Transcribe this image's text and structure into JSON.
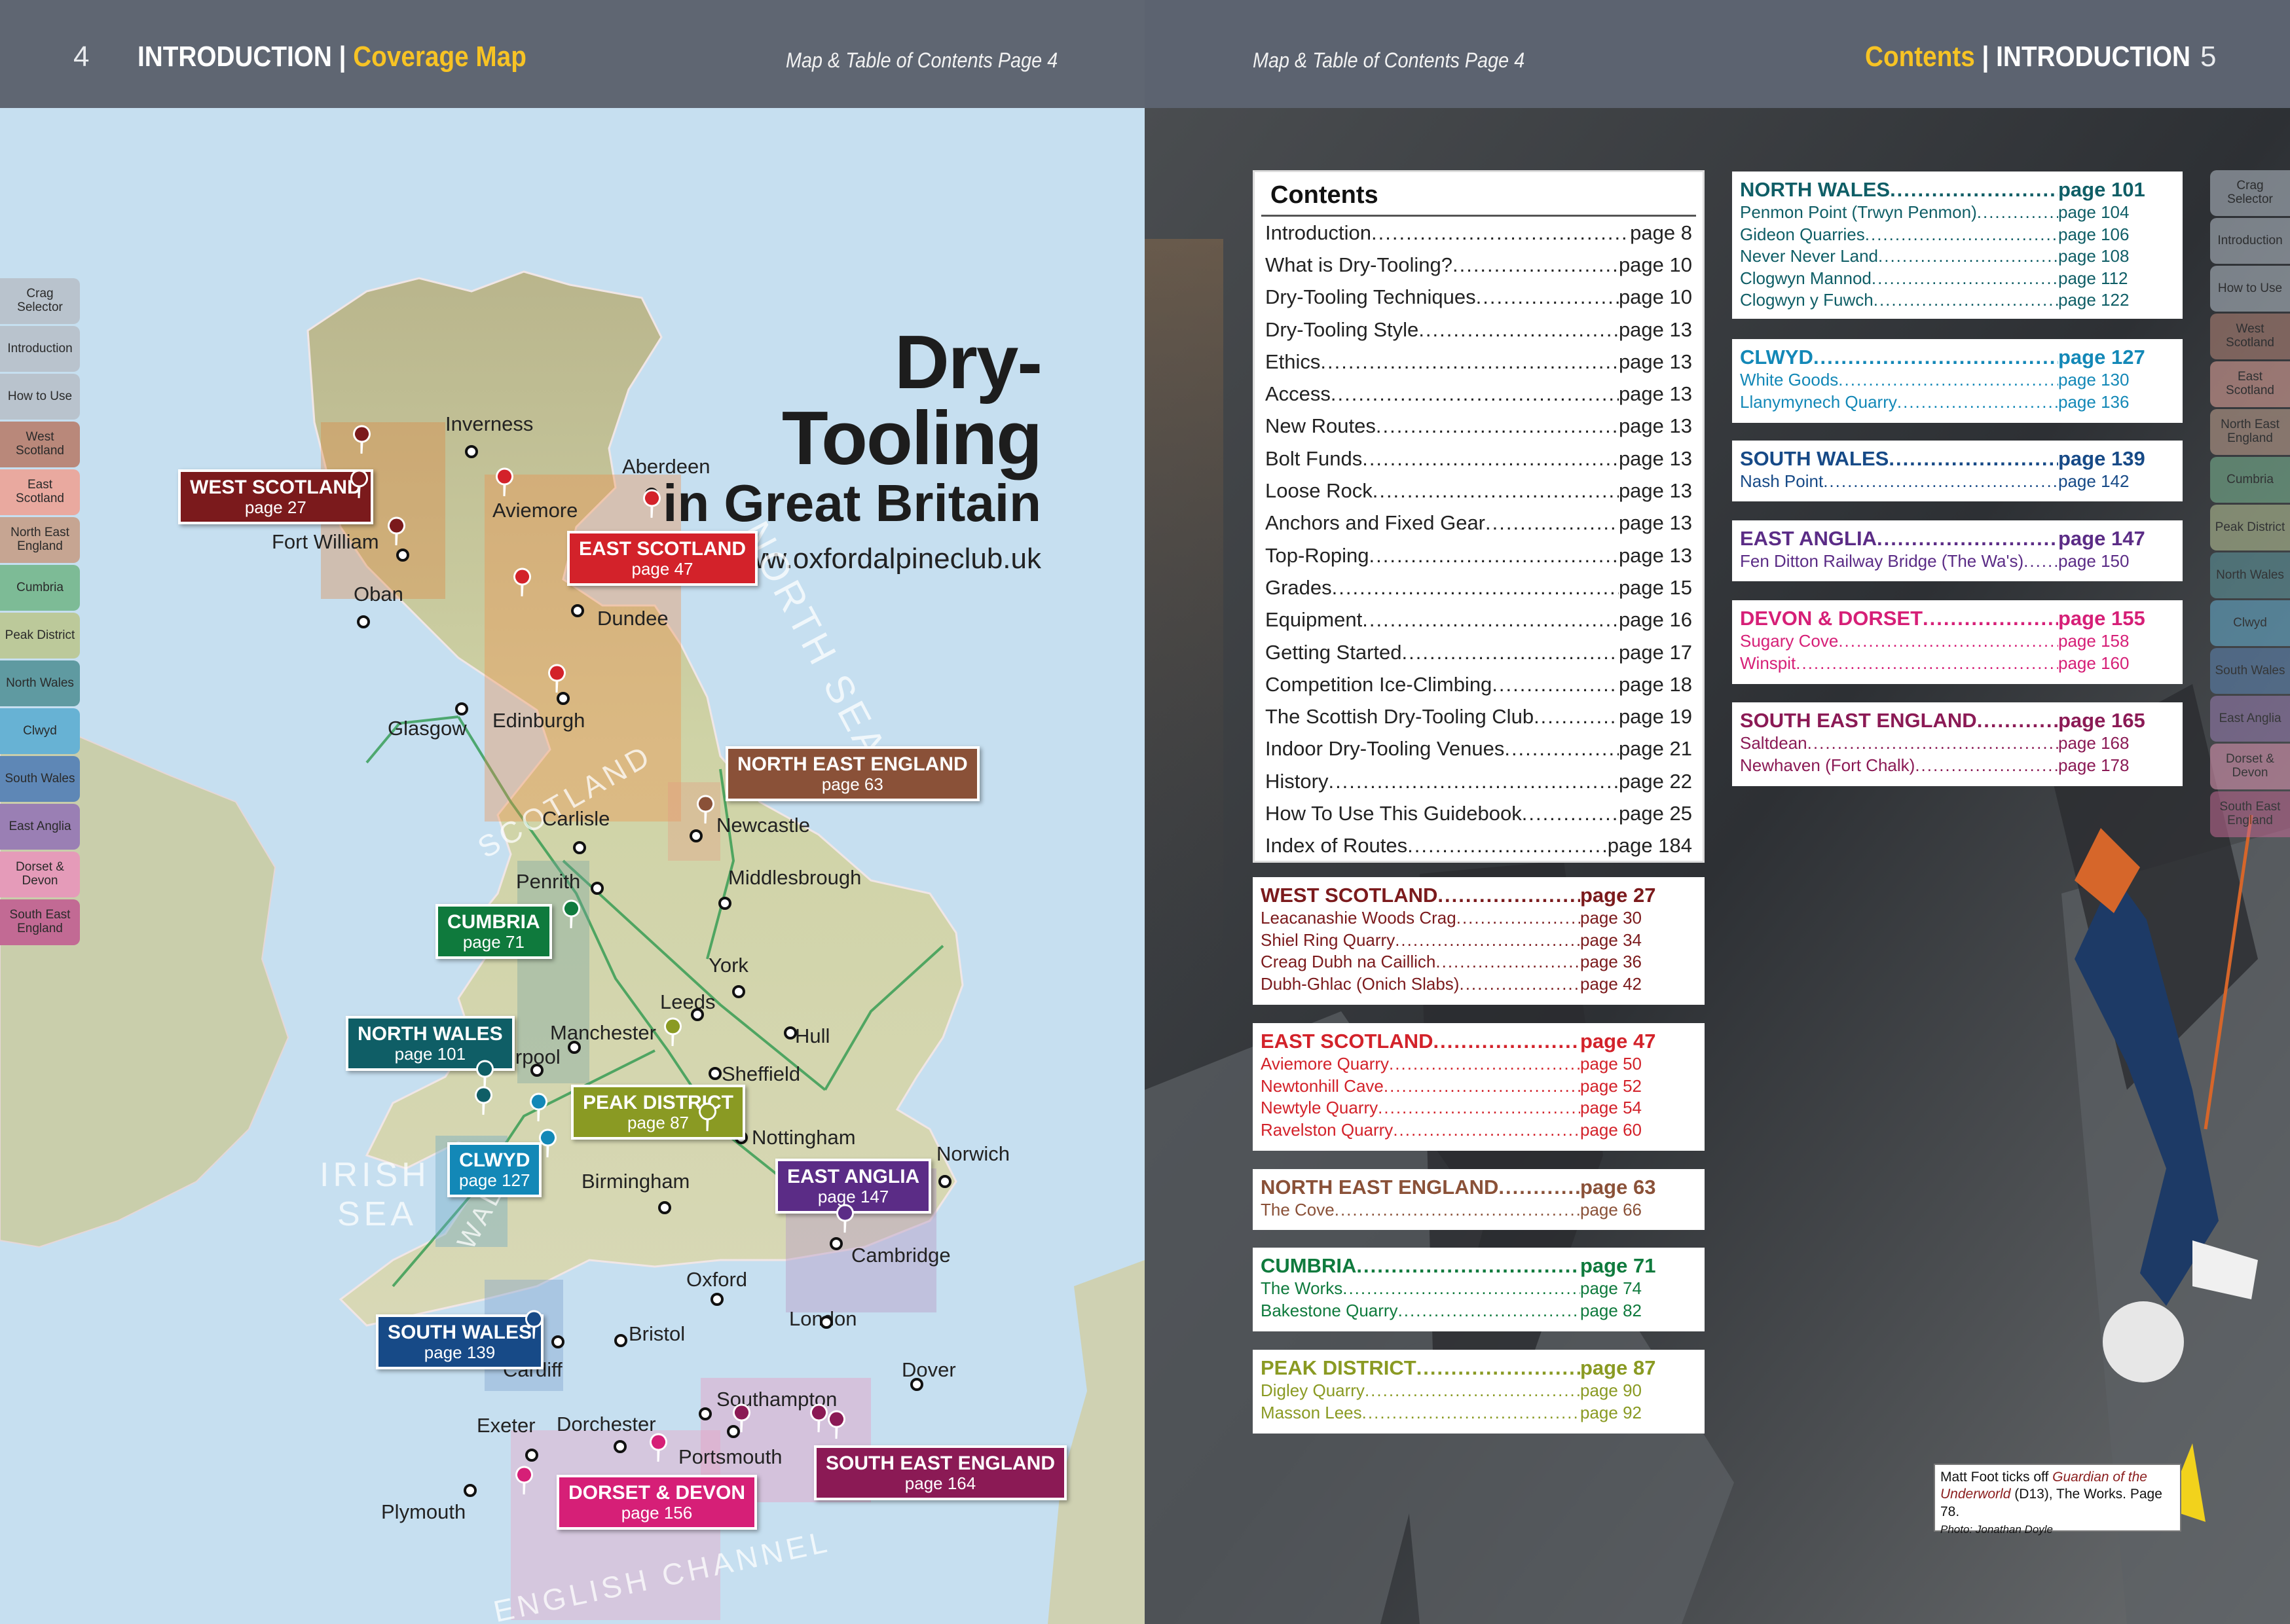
{
  "header_left": {
    "page_number": "4",
    "section": "INTRODUCTION",
    "separator": "|",
    "subsection": "Coverage Map",
    "map_ref": "Map & Table of Contents Page 4"
  },
  "header_right": {
    "map_ref": "Map & Table of Contents Page 4",
    "subsection": "Contents",
    "separator": "|",
    "section": "INTRODUCTION",
    "page_number": "5"
  },
  "side_tabs": [
    {
      "label": "Crag Selector",
      "color": "#b9c3cd"
    },
    {
      "label": "Introduction",
      "color": "#b9c3cd"
    },
    {
      "label": "How to Use",
      "color": "#b9c3cd"
    },
    {
      "label": "West Scotland",
      "color": "#b9887a"
    },
    {
      "label": "East Scotland",
      "color": "#e9a99f"
    },
    {
      "label": "North East England",
      "color": "#c6a592"
    },
    {
      "label": "Cumbria",
      "color": "#7dbb96"
    },
    {
      "label": "Peak District",
      "color": "#bcc99a"
    },
    {
      "label": "North Wales",
      "color": "#5f9aa1"
    },
    {
      "label": "Clwyd",
      "color": "#67b2d4"
    },
    {
      "label": "South Wales",
      "color": "#5e87b6"
    },
    {
      "label": "East Anglia",
      "color": "#9a7fb4"
    },
    {
      "label": "Dorset & Devon",
      "color": "#e59bb9"
    },
    {
      "label": "South East England",
      "color": "#c26a94"
    }
  ],
  "map_title": {
    "line1": "Dry-Tooling",
    "line2": "in Great Britain",
    "url": "www.oxfordalpineclub.uk"
  },
  "towns": [
    "Inverness",
    "Aberdeen",
    "Aviemore",
    "Fort William",
    "Oban",
    "Dundee",
    "Glasgow",
    "Edinburgh",
    "Carlisle",
    "Newcastle",
    "Penrith",
    "Middlesbrough",
    "York",
    "Leeds",
    "Hull",
    "Manchester",
    "Liverpool",
    "Sheffield",
    "Nottingham",
    "Norwich",
    "Birmingham",
    "Cambridge",
    "Oxford",
    "London",
    "Bristol",
    "Cardiff",
    "Dover",
    "Southampton",
    "Exeter",
    "Dorchester",
    "Portsmouth",
    "Plymouth"
  ],
  "seas": [
    "NORTH SEA",
    "IRISH",
    "SEA",
    "ENGLISH CHANNEL",
    "SCOTLAND",
    "WALES"
  ],
  "regions": [
    {
      "name": "WEST SCOTLAND",
      "page": "page 27",
      "color": "#7b1a1c"
    },
    {
      "name": "EAST SCOTLAND",
      "page": "page 47",
      "color": "#d3222a"
    },
    {
      "name": "NORTH EAST ENGLAND",
      "page": "page 63",
      "color": "#8a5138"
    },
    {
      "name": "CUMBRIA",
      "page": "page 71",
      "color": "#0f7a3d"
    },
    {
      "name": "NORTH WALES",
      "page": "page 101",
      "color": "#0f5e66"
    },
    {
      "name": "PEAK DISTRICT",
      "page": "page 87",
      "color": "#8a9a23"
    },
    {
      "name": "CLWYD",
      "page": "page 127",
      "color": "#1388b7"
    },
    {
      "name": "EAST ANGLIA",
      "page": "page 147",
      "color": "#5b2c86"
    },
    {
      "name": "SOUTH WALES",
      "page": "page 139",
      "color": "#174a87"
    },
    {
      "name": "DORSET & DEVON",
      "page": "page 156",
      "color": "#d61f77"
    },
    {
      "name": "SOUTH EAST ENGLAND",
      "page": "page 164",
      "color": "#8b1a55"
    }
  ],
  "contents": {
    "heading": "Contents",
    "rows": [
      {
        "label": "Introduction",
        "page": "page 8"
      },
      {
        "label": "What is Dry-Tooling?",
        "page": "page 10"
      },
      {
        "label": "Dry-Tooling Techniques",
        "page": "page 10"
      },
      {
        "label": "Dry-Tooling Style",
        "page": "page 13"
      },
      {
        "label": "Ethics",
        "page": "page 13"
      },
      {
        "label": "Access",
        "page": "page 13"
      },
      {
        "label": "New Routes",
        "page": "page 13"
      },
      {
        "label": "Bolt Funds",
        "page": "page 13"
      },
      {
        "label": "Loose Rock",
        "page": "page 13"
      },
      {
        "label": "Anchors and Fixed Gear",
        "page": "page 13"
      },
      {
        "label": "Top-Roping",
        "page": "page 13"
      },
      {
        "label": "Grades",
        "page": "page 15"
      },
      {
        "label": "Equipment",
        "page": "page 16"
      },
      {
        "label": "Getting Started",
        "page": "page 17"
      },
      {
        "label": "Competition Ice-Climbing",
        "page": "page 18"
      },
      {
        "label": "The Scottish Dry-Tooling Club",
        "page": "page 19"
      },
      {
        "label": "Indoor Dry-Tooling Venues",
        "page": "page 21"
      },
      {
        "label": "History",
        "page": "page 22"
      },
      {
        "label": "How To Use This Guidebook",
        "page": "page 25"
      },
      {
        "label": "Index of Routes",
        "page": "page 184"
      }
    ]
  },
  "sections_left": [
    {
      "title": "WEST SCOTLAND",
      "page": "page 27",
      "color": "#7b1a1c",
      "items": [
        {
          "label": "Leacanashie Woods Crag",
          "page": "page 30"
        },
        {
          "label": "Shiel Ring Quarry",
          "page": "page 34"
        },
        {
          "label": "Creag Dubh na Caillich",
          "page": "page 36"
        },
        {
          "label": "Dubh-Ghlac (Onich Slabs)",
          "page": "page 42"
        }
      ]
    },
    {
      "title": "EAST SCOTLAND",
      "page": "page 47",
      "color": "#d3222a",
      "items": [
        {
          "label": "Aviemore Quarry",
          "page": "page 50"
        },
        {
          "label": "Newtonhill Cave",
          "page": "page 52"
        },
        {
          "label": "Newtyle Quarry",
          "page": "page 54"
        },
        {
          "label": "Ravelston Quarry",
          "page": "page 60"
        }
      ]
    },
    {
      "title": "NORTH EAST ENGLAND",
      "page": "page 63",
      "color": "#8a5138",
      "items": [
        {
          "label": "The Cove",
          "page": "page 66"
        }
      ]
    },
    {
      "title": "CUMBRIA",
      "page": "page 71",
      "color": "#0f7a3d",
      "items": [
        {
          "label": "The Works",
          "page": "page 74"
        },
        {
          "label": "Bakestone Quarry",
          "page": "page 82"
        }
      ]
    },
    {
      "title": "PEAK DISTRICT",
      "page": "page 87",
      "color": "#8a9a23",
      "items": [
        {
          "label": "Digley Quarry",
          "page": "page 90"
        },
        {
          "label": "Masson Lees",
          "page": "page 92"
        }
      ]
    }
  ],
  "sections_right": [
    {
      "title": "NORTH WALES",
      "page": "page 101",
      "color": "#0f5e66",
      "items": [
        {
          "label": "Penmon Point (Trwyn Penmon)",
          "page": "page 104"
        },
        {
          "label": "Gideon Quarries",
          "page": "page 106"
        },
        {
          "label": "Never Never Land",
          "page": "page 108"
        },
        {
          "label": "Clogwyn Mannod",
          "page": "page 112"
        },
        {
          "label": "Clogwyn y Fuwch",
          "page": "page 122"
        }
      ]
    },
    {
      "title": "CLWYD",
      "page": "page 127",
      "color": "#1388b7",
      "items": [
        {
          "label": "White Goods",
          "page": "page 130"
        },
        {
          "label": "Llanymynech Quarry",
          "page": "page 136"
        }
      ]
    },
    {
      "title": "SOUTH WALES",
      "page": "page 139",
      "color": "#174a87",
      "items": [
        {
          "label": "Nash Point",
          "page": "page 142"
        }
      ]
    },
    {
      "title": "EAST ANGLIA",
      "page": "page 147",
      "color": "#5b2c86",
      "items": [
        {
          "label": "Fen Ditton Railway Bridge (The Wa's)",
          "page": "page 150"
        }
      ]
    },
    {
      "title": "DEVON & DORSET",
      "page": "page 155",
      "color": "#d61f77",
      "items": [
        {
          "label": "Sugary Cove",
          "page": "page 158"
        },
        {
          "label": "Winspit",
          "page": "page 160"
        }
      ]
    },
    {
      "title": "SOUTH EAST ENGLAND",
      "page": "page 165",
      "color": "#8b1a55",
      "items": [
        {
          "label": "Saltdean",
          "page": "page 168"
        },
        {
          "label": "Newhaven (Fort Chalk)",
          "page": "page 178"
        }
      ]
    }
  ],
  "caption": {
    "pre": "Matt Foot ticks off ",
    "route": "Guardian of the Underworld",
    "post": " (D13), The Works. Page 78.",
    "credit": "Photo: Jonathan Doyle"
  }
}
